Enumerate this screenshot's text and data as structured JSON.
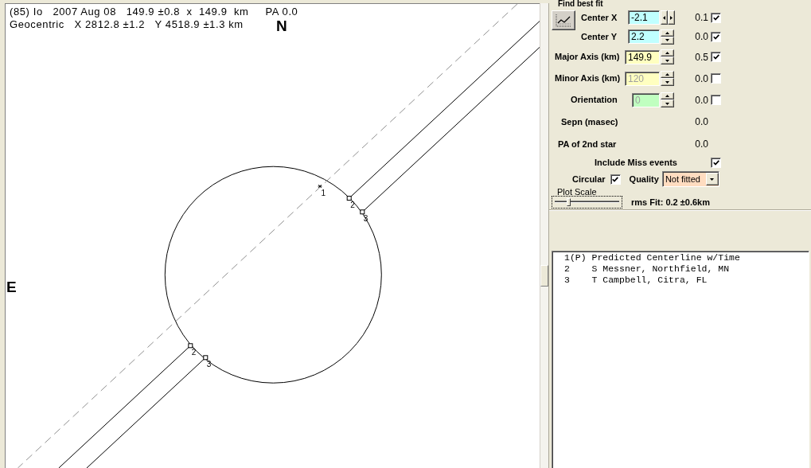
{
  "plot": {
    "header": [
      "(85) Io   2007 Aug 08   149.9 ±0.8  x  149.9  km     PA 0.0",
      "Geocentric   X 2812.8 ±1.2   Y 4518.9 ±1.3 km"
    ],
    "north": "N",
    "east": "E",
    "chords": [
      {
        "kind": "predicted",
        "labels": [
          "1"
        ]
      },
      {
        "kind": "observed",
        "labels": [
          "2",
          "2"
        ]
      },
      {
        "kind": "observed",
        "labels": [
          "3",
          "3"
        ]
      }
    ]
  },
  "fit": {
    "title": "Find best fit",
    "params": [
      {
        "label": "Center X",
        "value": "-2.1",
        "color": "#c0ffff",
        "disabled": false,
        "kind": "horizontal",
        "step": "0.1",
        "checked": true
      },
      {
        "label": "Center Y",
        "value": "2.2",
        "color": "#c0ffff",
        "disabled": false,
        "kind": "vertical",
        "step": "0.0",
        "checked": true
      },
      {
        "label": "Major Axis (km)",
        "value": "149.9",
        "color": "#ffffc0",
        "disabled": false,
        "kind": "vertical",
        "step": "0.5",
        "checked": true
      },
      {
        "label": "Minor Axis (km)",
        "value": "120",
        "color": "#ffffc0",
        "disabled": true,
        "kind": "vertical",
        "step": "0.0",
        "checked": false
      },
      {
        "label": "Orientation",
        "value": "0",
        "color": "#c0ffc0",
        "disabled": true,
        "kind": "vertical",
        "step": "0.0",
        "checked": false
      }
    ],
    "stats": [
      {
        "label": "Sepn (masec)",
        "value": "0.0"
      },
      {
        "label": "PA of 2nd star",
        "value": "0.0"
      }
    ],
    "include_miss": {
      "label": "Include Miss events",
      "checked": true
    },
    "circular": {
      "label": "Circular",
      "checked": true
    },
    "quality": {
      "label": "Quality",
      "value": "Not fitted"
    },
    "plot_scale": {
      "label": "Plot Scale",
      "level": 0.2
    },
    "rms_fit": "rms Fit: 0.2 ±0.6km"
  },
  "observers": [
    {
      "text": "1(P) Predicted Centerline w/Time",
      "selected": false
    },
    {
      "text": "2    S Messner, Northfield, MN",
      "selected": false
    },
    {
      "text": "3    T Campbell, Citra, FL",
      "selected": false
    }
  ]
}
